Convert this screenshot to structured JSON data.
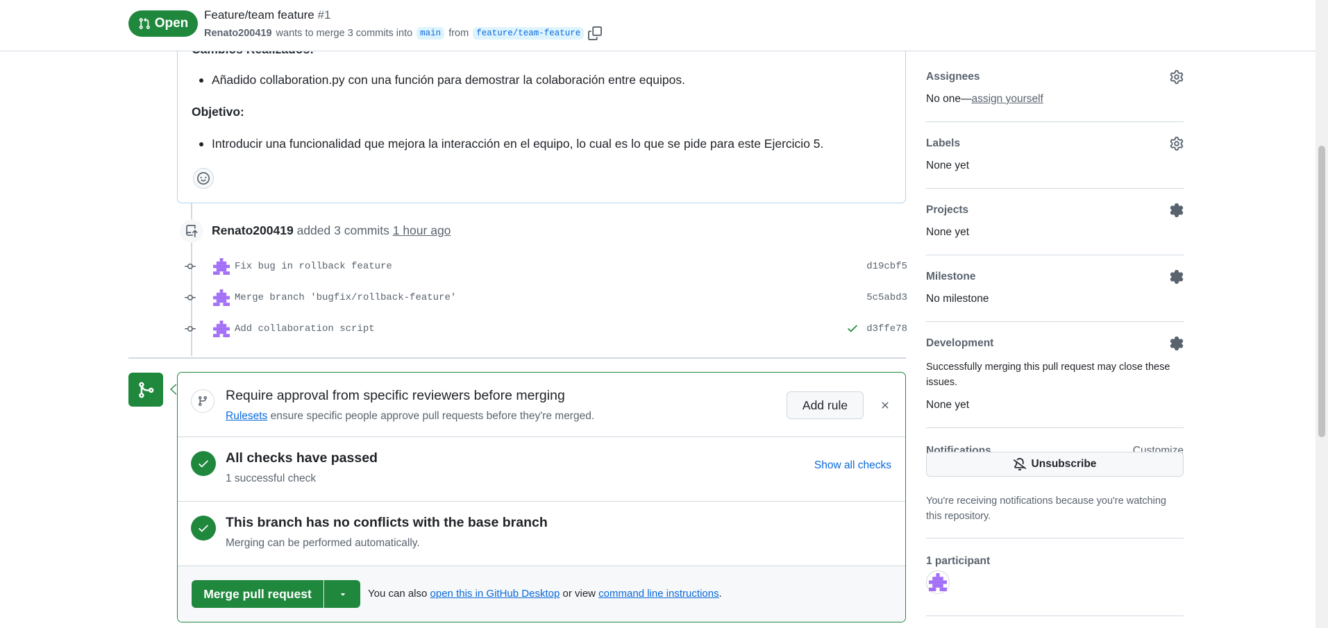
{
  "header": {
    "state": "Open",
    "title": "Feature/team feature",
    "number": "#1",
    "author": "Renato200419",
    "merge_text": "wants to merge 3 commits into",
    "base_branch": "main",
    "from_text": "from",
    "head_branch": "feature/team-feature"
  },
  "description": {
    "cut_heading": "Cambios Realizados:",
    "bullet_1": "Añadido collaboration.py con una función para demostrar la colaboración entre equipos.",
    "objective_heading": "Objetivo:",
    "bullet_2": "Introducir una funcionalidad que mejora la interacción en el equipo, lo cual es lo que se pide para este Ejercicio 5."
  },
  "timeline": {
    "user": "Renato200419",
    "action": "added 3 commits",
    "time": "1 hour ago",
    "commits": [
      {
        "message": "Fix bug in rollback feature",
        "sha": "d19cbf5"
      },
      {
        "message": "Merge branch 'bugfix/rollback-feature'",
        "sha": "5c5abd3"
      },
      {
        "message": "Add collaboration script",
        "sha": "d3ffe78"
      }
    ]
  },
  "merge_box": {
    "rule_title": "Require approval from specific reviewers before merging",
    "rule_link": "Rulesets",
    "rule_desc": "ensure specific people approve pull requests before they're merged.",
    "add_rule": "Add rule",
    "checks_title": "All checks have passed",
    "checks_sub": "1 successful check",
    "show_checks": "Show all checks",
    "conflicts_title": "This branch has no conflicts with the base branch",
    "conflicts_sub": "Merging can be performed automatically.",
    "merge_button": "Merge pull request",
    "also_prefix": "You can also",
    "desktop_link": "open this in GitHub Desktop",
    "or_view": "or view",
    "cli_link": "command line instructions",
    "period": "."
  },
  "sidebar": {
    "assignees_head": "Assignees",
    "assignees_none": "No one—",
    "assign_yourself": "assign yourself",
    "labels_head": "Labels",
    "labels_val": "None yet",
    "projects_head": "Projects",
    "projects_val": "None yet",
    "milestone_head": "Milestone",
    "milestone_val": "No milestone",
    "development_head": "Development",
    "development_desc": "Successfully merging this pull request may close these issues.",
    "development_val": "None yet",
    "notifications_head": "Notifications",
    "customize": "Customize",
    "unsubscribe": "Unsubscribe",
    "notif_reason": "You're receiving notifications because you're watching this repository.",
    "participants_head": "1 participant"
  },
  "colors": {
    "accent_green": "#1f883d",
    "link_blue": "#0969da",
    "muted": "#59636e",
    "avatar_purple": "#a371f7"
  },
  "icons": [
    "git-pull-request-icon",
    "copy-icon",
    "smiley-icon",
    "repo-push-icon",
    "git-commit-icon",
    "check-icon",
    "git-merge-icon",
    "git-branch-icon",
    "x-icon",
    "triangle-down-icon",
    "gear-icon",
    "bell-slash-icon",
    "identicon-avatar"
  ]
}
